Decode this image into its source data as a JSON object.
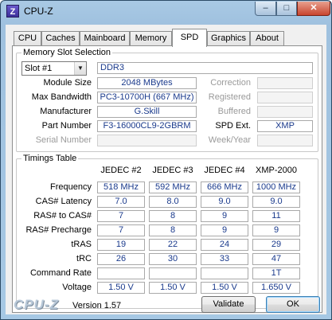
{
  "window": {
    "title": "CPU-Z",
    "icon_letter": "Z",
    "minimize": "–",
    "maximize": "□",
    "close": "✕"
  },
  "tabs": [
    {
      "label": "CPU"
    },
    {
      "label": "Caches"
    },
    {
      "label": "Mainboard"
    },
    {
      "label": "Memory"
    },
    {
      "label": "SPD",
      "active": true
    },
    {
      "label": "Graphics"
    },
    {
      "label": "About"
    }
  ],
  "slot": {
    "group_title": "Memory Slot Selection",
    "selected": "Slot #1",
    "type": "DDR3",
    "module_size_label": "Module Size",
    "module_size": "2048 MBytes",
    "max_bandwidth_label": "Max Bandwidth",
    "max_bandwidth": "PC3-10700H (667 MHz)",
    "manufacturer_label": "Manufacturer",
    "manufacturer": "G.Skill",
    "part_number_label": "Part Number",
    "part_number": "F3-16000CL9-2GBRM",
    "serial_number_label": "Serial Number",
    "serial_number": "",
    "correction_label": "Correction",
    "correction": "",
    "registered_label": "Registered",
    "registered": "",
    "buffered_label": "Buffered",
    "buffered": "",
    "spd_ext_label": "SPD Ext.",
    "spd_ext": "XMP",
    "week_year_label": "Week/Year",
    "week_year": ""
  },
  "timings": {
    "group_title": "Timings Table",
    "columns": [
      "JEDEC #2",
      "JEDEC #3",
      "JEDEC #4",
      "XMP-2000"
    ],
    "rows": [
      {
        "label": "Frequency",
        "values": [
          "518 MHz",
          "592 MHz",
          "666 MHz",
          "1000 MHz"
        ]
      },
      {
        "label": "CAS# Latency",
        "values": [
          "7.0",
          "8.0",
          "9.0",
          "9.0"
        ]
      },
      {
        "label": "RAS# to CAS#",
        "values": [
          "7",
          "8",
          "9",
          "11"
        ]
      },
      {
        "label": "RAS# Precharge",
        "values": [
          "7",
          "8",
          "9",
          "9"
        ]
      },
      {
        "label": "tRAS",
        "values": [
          "19",
          "22",
          "24",
          "29"
        ]
      },
      {
        "label": "tRC",
        "values": [
          "26",
          "30",
          "33",
          "47"
        ]
      },
      {
        "label": "Command Rate",
        "values": [
          "",
          "",
          "",
          "1T"
        ]
      },
      {
        "label": "Voltage",
        "values": [
          "1.50 V",
          "1.50 V",
          "1.50 V",
          "1.650 V"
        ]
      }
    ]
  },
  "footer": {
    "logo": "CPU-Z",
    "version": "Version 1.57",
    "validate": "Validate",
    "ok": "OK"
  }
}
